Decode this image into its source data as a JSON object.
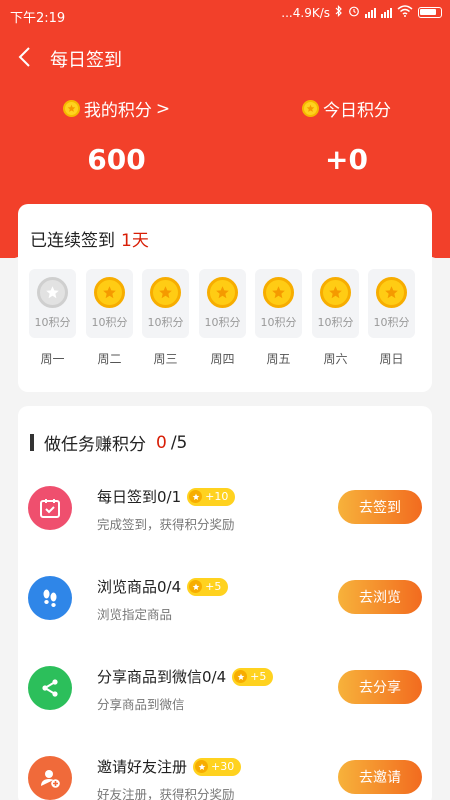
{
  "status": {
    "time": "下午2:19",
    "speed": "...4.9K/s"
  },
  "header": {
    "title": "每日签到"
  },
  "points": {
    "my_label": "我的积分",
    "my_arrow": ">",
    "my_value": "600",
    "today_label": "今日积分",
    "today_value": "+0"
  },
  "signin": {
    "streak_label": "已连续签到",
    "streak_days": "1天",
    "days": [
      {
        "points": "10积分",
        "weekday": "周一",
        "checked": false
      },
      {
        "points": "10积分",
        "weekday": "周二",
        "checked": true
      },
      {
        "points": "10积分",
        "weekday": "周三",
        "checked": true
      },
      {
        "points": "10积分",
        "weekday": "周四",
        "checked": true
      },
      {
        "points": "10积分",
        "weekday": "周五",
        "checked": true
      },
      {
        "points": "10积分",
        "weekday": "周六",
        "checked": true
      },
      {
        "points": "10积分",
        "weekday": "周日",
        "checked": true
      }
    ]
  },
  "tasks": {
    "heading": "做任务赚积分",
    "done": "0",
    "total": "/5",
    "items": [
      {
        "name": "每日签到0/1",
        "reward": "+10",
        "desc": "完成签到，获得积分奖励",
        "button": "去签到",
        "icon": "calendar-check-icon",
        "color": "#ef4f6e"
      },
      {
        "name": "浏览商品0/4",
        "reward": "+5",
        "desc": "浏览指定商品",
        "button": "去浏览",
        "icon": "footprints-icon",
        "color": "#2f86e8"
      },
      {
        "name": "分享商品到微信0/4",
        "reward": "+5",
        "desc": "分享商品到微信",
        "button": "去分享",
        "icon": "share-icon",
        "color": "#2cbf5b"
      },
      {
        "name": "邀请好友注册",
        "reward": "+30",
        "desc": "好友注册，获得积分奖励",
        "button": "去邀请",
        "icon": "user-add-icon",
        "color": "#f06a3a"
      }
    ]
  },
  "colors": {
    "primary": "#f2402a",
    "accent": "#d81e06",
    "coin": "#ffcc14",
    "button_start": "#f7b23b",
    "button_end": "#f26b1f"
  }
}
